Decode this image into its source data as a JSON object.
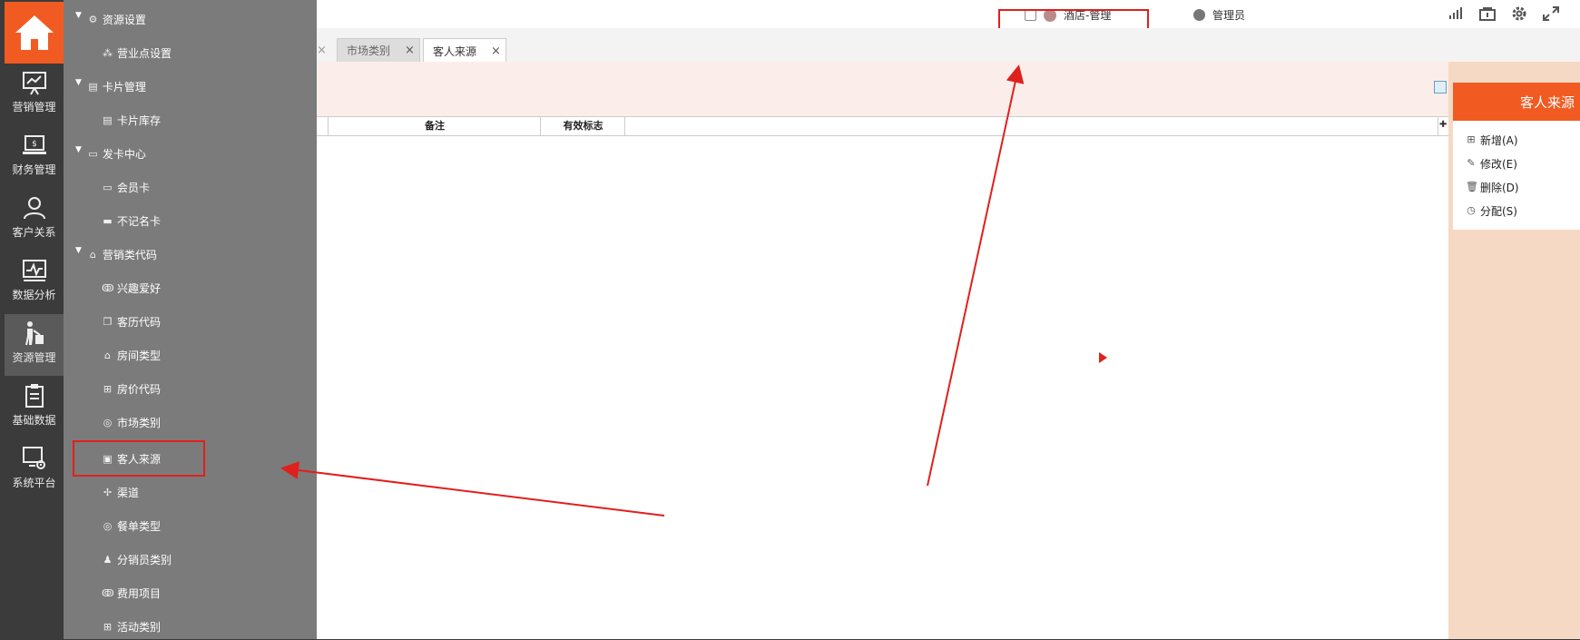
{
  "rail": {
    "items": [
      {
        "label": "营销管理",
        "icon": "chart-board-icon"
      },
      {
        "label": "财务管理",
        "icon": "laptop-money-icon"
      },
      {
        "label": "客户关系",
        "icon": "people-icon"
      },
      {
        "label": "数据分析",
        "icon": "line-chart-icon"
      },
      {
        "label": "资源管理",
        "icon": "bellhop-luggage-icon"
      },
      {
        "label": "基础数据",
        "icon": "clipboard-icon"
      },
      {
        "label": "系统平台",
        "icon": "monitor-gear-icon"
      }
    ]
  },
  "submenu": {
    "groups": [
      {
        "label": "资源设置",
        "items": [
          "营业点设置"
        ]
      },
      {
        "label": "卡片管理",
        "items": [
          "卡片库存"
        ]
      },
      {
        "label": "发卡中心",
        "items": [
          "会员卡",
          "不记名卡"
        ]
      },
      {
        "label": "营销类代码",
        "items": [
          "兴趣爱好",
          "客历代码",
          "房间类型",
          "房价代码",
          "市场类别",
          "客人来源",
          "渠道",
          "餐单类型",
          "分销员类别",
          "费用项目",
          "活动类别"
        ]
      }
    ]
  },
  "topbar": {
    "hotel": "酒店-管理",
    "user": "管理员"
  },
  "tabs": [
    {
      "label": "市场类别",
      "active": false
    },
    {
      "label": "客人来源",
      "active": true
    }
  ],
  "grid": {
    "columns": [
      "备注",
      "有效标志"
    ]
  },
  "rpanel": {
    "title": "客人来源",
    "actions": [
      "新增(A)",
      "修改(E)",
      "删除(D)",
      "分配(S)"
    ]
  },
  "colors": {
    "accent": "#f15b22",
    "annotation": "#e0201c"
  }
}
